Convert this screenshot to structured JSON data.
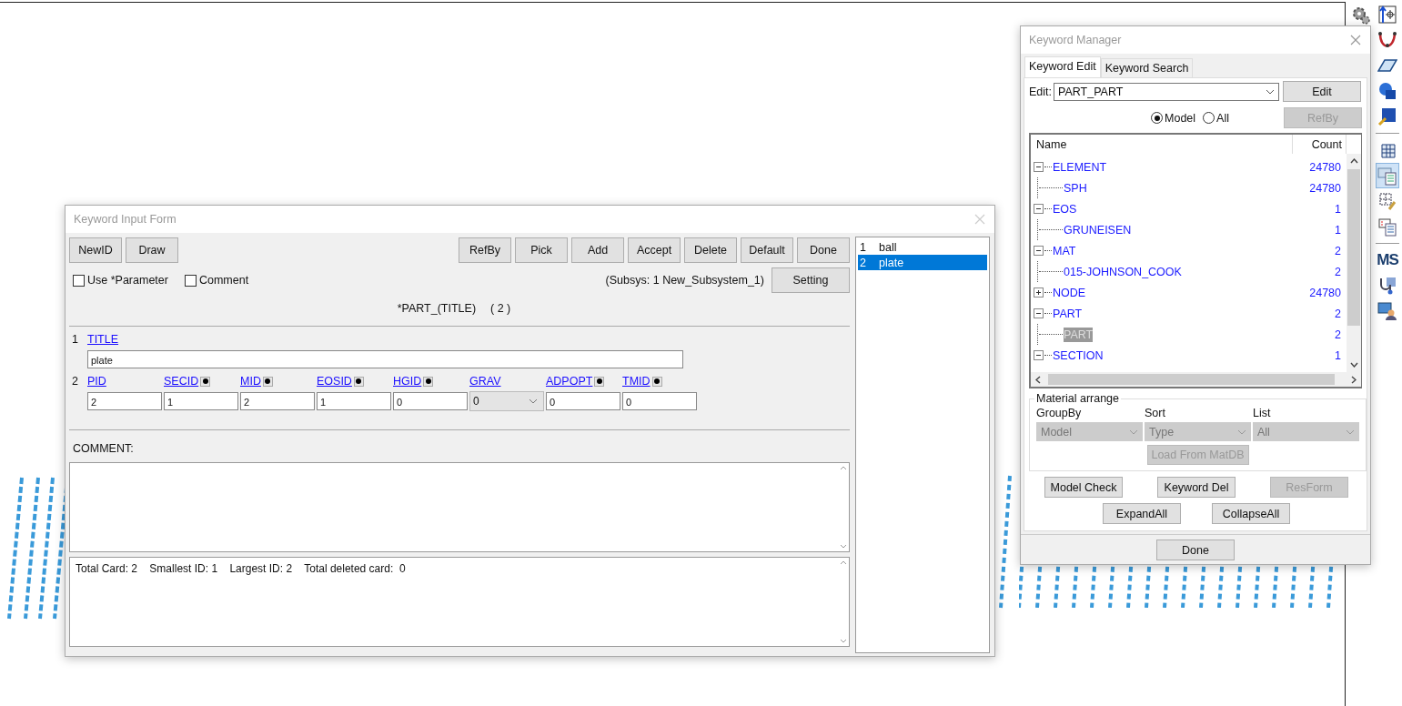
{
  "toolbar": [
    {
      "kind": "gear",
      "selected": false
    },
    {
      "kind": "node-arrow",
      "selected": false
    },
    {
      "kind": "curve",
      "selected": false
    },
    {
      "kind": "surface",
      "selected": false
    },
    {
      "kind": "solid",
      "selected": false
    },
    {
      "kind": "solid-tool",
      "selected": false
    },
    {
      "kind": "separator"
    },
    {
      "kind": "mesh",
      "selected": false
    },
    {
      "kind": "table-list",
      "selected": true
    },
    {
      "kind": "mesh-tool",
      "selected": false
    },
    {
      "kind": "list-edit",
      "selected": false
    },
    {
      "kind": "separator"
    },
    {
      "kind": "text-logo",
      "label": "MS",
      "selected": false
    },
    {
      "kind": "stethoscope",
      "selected": false
    },
    {
      "kind": "user-panel",
      "selected": false
    }
  ],
  "input_form": {
    "title": "Keyword Input Form",
    "left_buttons": [
      "NewID",
      "Draw"
    ],
    "right_buttons": [
      "RefBy",
      "Pick",
      "Add",
      "Accept",
      "Delete",
      "Default",
      "Done"
    ],
    "options": [
      {
        "label": "Use *Parameter",
        "checked": false
      },
      {
        "label": "Comment",
        "checked": false
      }
    ],
    "subsys": "(Subsys: 1 New_Subsystem_1)",
    "setting_button": "Setting",
    "keyword_heading": "*PART_(TITLE)",
    "keyword_count": "( 2 )",
    "cards": [
      {
        "number": "1",
        "fields": [
          {
            "label": "TITLE",
            "kind": "wide",
            "value": "plate",
            "pick": false
          }
        ]
      },
      {
        "number": "2",
        "fields": [
          {
            "label": "PID",
            "kind": "text",
            "value": "2",
            "pick": false
          },
          {
            "label": "SECID",
            "kind": "text",
            "value": "1",
            "pick": true
          },
          {
            "label": "MID",
            "kind": "text",
            "value": "2",
            "pick": true
          },
          {
            "label": "EOSID",
            "kind": "text",
            "value": "1",
            "pick": true
          },
          {
            "label": "HGID",
            "kind": "text",
            "value": "0",
            "pick": true
          },
          {
            "label": "GRAV",
            "kind": "select",
            "value": "0",
            "pick": false
          },
          {
            "label": "ADPOPT",
            "kind": "text",
            "value": "0",
            "pick": true
          },
          {
            "label": "TMID",
            "kind": "text",
            "value": "0",
            "pick": true
          }
        ]
      }
    ],
    "comment_label": "COMMENT:",
    "summary": "Total Card: 2    Smallest ID: 1    Largest ID: 2    Total deleted card:  0",
    "records": [
      {
        "number": "1",
        "name": "ball",
        "selected": false
      },
      {
        "number": "2",
        "name": "plate",
        "selected": true
      }
    ]
  },
  "keyword_manager": {
    "title": "Keyword Manager",
    "tabs": [
      {
        "label": "Keyword Edit",
        "selected": true
      },
      {
        "label": "Keyword Search",
        "selected": false
      }
    ],
    "edit_label": "Edit:",
    "edit_value": "PART_PART",
    "edit_button": "Edit",
    "scope": [
      {
        "label": "Model",
        "selected": true
      },
      {
        "label": "All",
        "selected": false
      }
    ],
    "refby_button": {
      "label": "RefBy",
      "disabled": true
    },
    "tree": {
      "columns": [
        "Name",
        "Count"
      ],
      "items": [
        {
          "name": "ELEMENT",
          "count": "24780",
          "expanded": true,
          "selected": false,
          "children": [
            {
              "name": "SPH",
              "count": "24780",
              "selected": false
            }
          ]
        },
        {
          "name": "EOS",
          "count": "1",
          "expanded": true,
          "selected": false,
          "children": [
            {
              "name": "GRUNEISEN",
              "count": "1",
              "selected": false
            }
          ]
        },
        {
          "name": "MAT",
          "count": "2",
          "expanded": true,
          "selected": false,
          "children": [
            {
              "name": "015-JOHNSON_COOK",
              "count": "2",
              "selected": false
            }
          ]
        },
        {
          "name": "NODE",
          "count": "24780",
          "expanded": false,
          "selected": false
        },
        {
          "name": "PART",
          "count": "2",
          "expanded": true,
          "selected": false,
          "children": [
            {
              "name": "PART",
              "count": "2",
              "selected": true
            }
          ]
        },
        {
          "name": "SECTION",
          "count": "1",
          "expanded": true,
          "selected": false
        }
      ]
    },
    "material_arrange": {
      "legend": "Material arrange",
      "selects": [
        {
          "label": "GroupBy",
          "value": "Model",
          "disabled": true
        },
        {
          "label": "Sort",
          "value": "Type",
          "disabled": true
        },
        {
          "label": "List",
          "value": "All",
          "disabled": true
        }
      ],
      "load_button": {
        "label": "Load From MatDB",
        "disabled": true
      }
    },
    "buttons": [
      {
        "label": "Model Check",
        "disabled": false
      },
      {
        "label": "Keyword Del",
        "disabled": false
      },
      {
        "label": "ResForm",
        "disabled": true
      }
    ],
    "buttons_row2": [
      {
        "label": "ExpandAll",
        "disabled": false
      },
      {
        "label": "CollapseAll",
        "disabled": false
      }
    ],
    "done_button": "Done"
  }
}
